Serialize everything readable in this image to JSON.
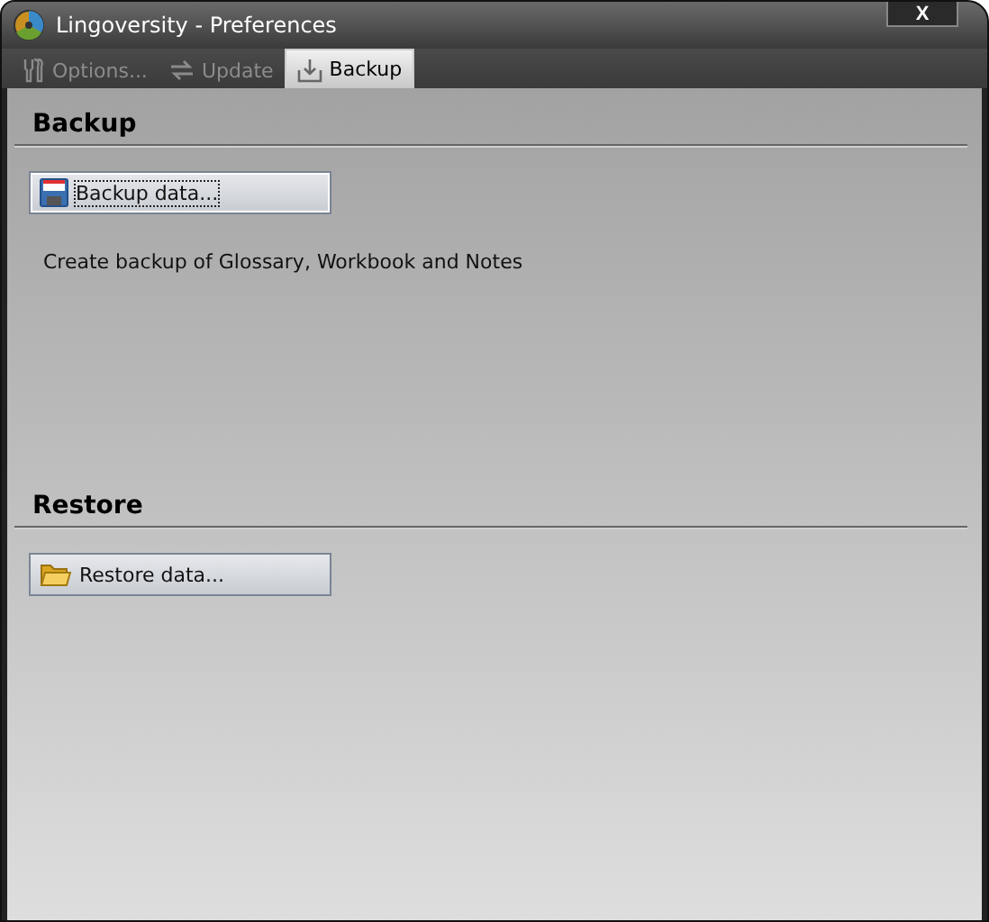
{
  "window": {
    "title": "Lingoversity - Preferences",
    "close": "X"
  },
  "tabs": [
    {
      "label": "Options...",
      "selected": false
    },
    {
      "label": "Update",
      "selected": false
    },
    {
      "label": "Backup",
      "selected": true
    }
  ],
  "sections": [
    {
      "heading": "Backup",
      "button": {
        "label": "Backup data...",
        "focused": true
      },
      "description": "Create backup of Glossary, Workbook and Notes"
    },
    {
      "heading": "Restore",
      "button": {
        "label": "Restore data...",
        "focused": false
      }
    }
  ]
}
